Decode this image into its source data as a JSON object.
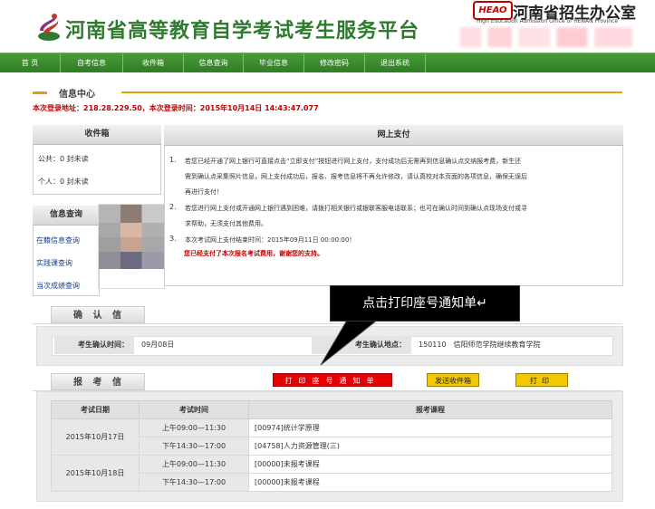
{
  "header": {
    "site_title": "河南省高等教育自学考试考生服务平台",
    "brand_badge": "HEAO",
    "brand_name": "河南省招生办公室",
    "brand_sub": "High Education Admission Office of HENAN Province"
  },
  "nav": {
    "items": [
      "首 页",
      "自考信息",
      "收件箱",
      "信息查询",
      "毕业信息",
      "修改密码",
      "退出系统"
    ]
  },
  "info_center": {
    "title": "信息中心",
    "login_info": "本次登录地址：218.28.229.50，本次登录时间：2015年10月14日 14:43:47.077"
  },
  "inbox": {
    "title": "收件箱",
    "public": "公共：0 封未读",
    "personal": "个人：0 封未读"
  },
  "info_query": {
    "title": "信息查询",
    "items": [
      "在籍信息查询",
      "实践课查询",
      "当次成绩查询"
    ]
  },
  "payment": {
    "title": "网上支付",
    "items": [
      {
        "num": "1.",
        "lines": [
          "若您已经开通了网上银行可直接点击“立即支付”按钮进行网上支付，支付成功后无需再到信息确认点交纳报考费，新生还",
          "需到确认点采集照片信息，网上支付成功后，报名、报考信息将不再允许修改，请认真校对本页面的各项信息，确保无误后",
          "再进行支付！"
        ]
      },
      {
        "num": "2.",
        "lines": [
          "若您进行网上支付或开通网上银行遇到困难，请拨打相关银行或银联客服电话联系；也可在确认时间到确认点现场支付或寻",
          "求帮助，无须支付其他费用。"
        ]
      },
      {
        "num": "3.",
        "lines": [
          "本次考试网上支付结束时间：2015年09月11日 00:00:00！"
        ]
      }
    ],
    "success": "您已经支付了本次报名考试费用，谢谢您的支持。"
  },
  "callout": {
    "text": "点击打印座号通知单↵"
  },
  "confirm": {
    "title": "确 认 信 息",
    "time_label": "考生确认时间：",
    "time_value": "09月08日",
    "place_label": "考生确认地点：",
    "place_value": "150110　信阳师范学院继续教育学院"
  },
  "registration": {
    "title": "报 考 信 息",
    "print_seat_label": "打印座号通知单",
    "send_inbox_label": "发送收件箱",
    "print_label": "打印",
    "columns": [
      "考试日期",
      "考试时间",
      "报考课程"
    ],
    "rows": [
      {
        "date": "2015年10月17日",
        "sessions": [
          {
            "time": "上午09:00—11:30",
            "course": "[00974]统计学原理"
          },
          {
            "time": "下午14:30—17:00",
            "course": "[04758]人力资源管理(三)"
          }
        ]
      },
      {
        "date": "2015年10月18日",
        "sessions": [
          {
            "time": "上午09:00—11:30",
            "course": "[00000]未报考课程"
          },
          {
            "time": "下午14:30—17:00",
            "course": "[00000]未报考课程"
          }
        ]
      }
    ]
  },
  "colors": {
    "nav_green": "#2f7d25",
    "title_green": "#2f7a2f",
    "accent_orange": "#e0a400",
    "alert_red": "#c00000",
    "button_red": "#e60000",
    "button_yellow": "#f3c800"
  }
}
